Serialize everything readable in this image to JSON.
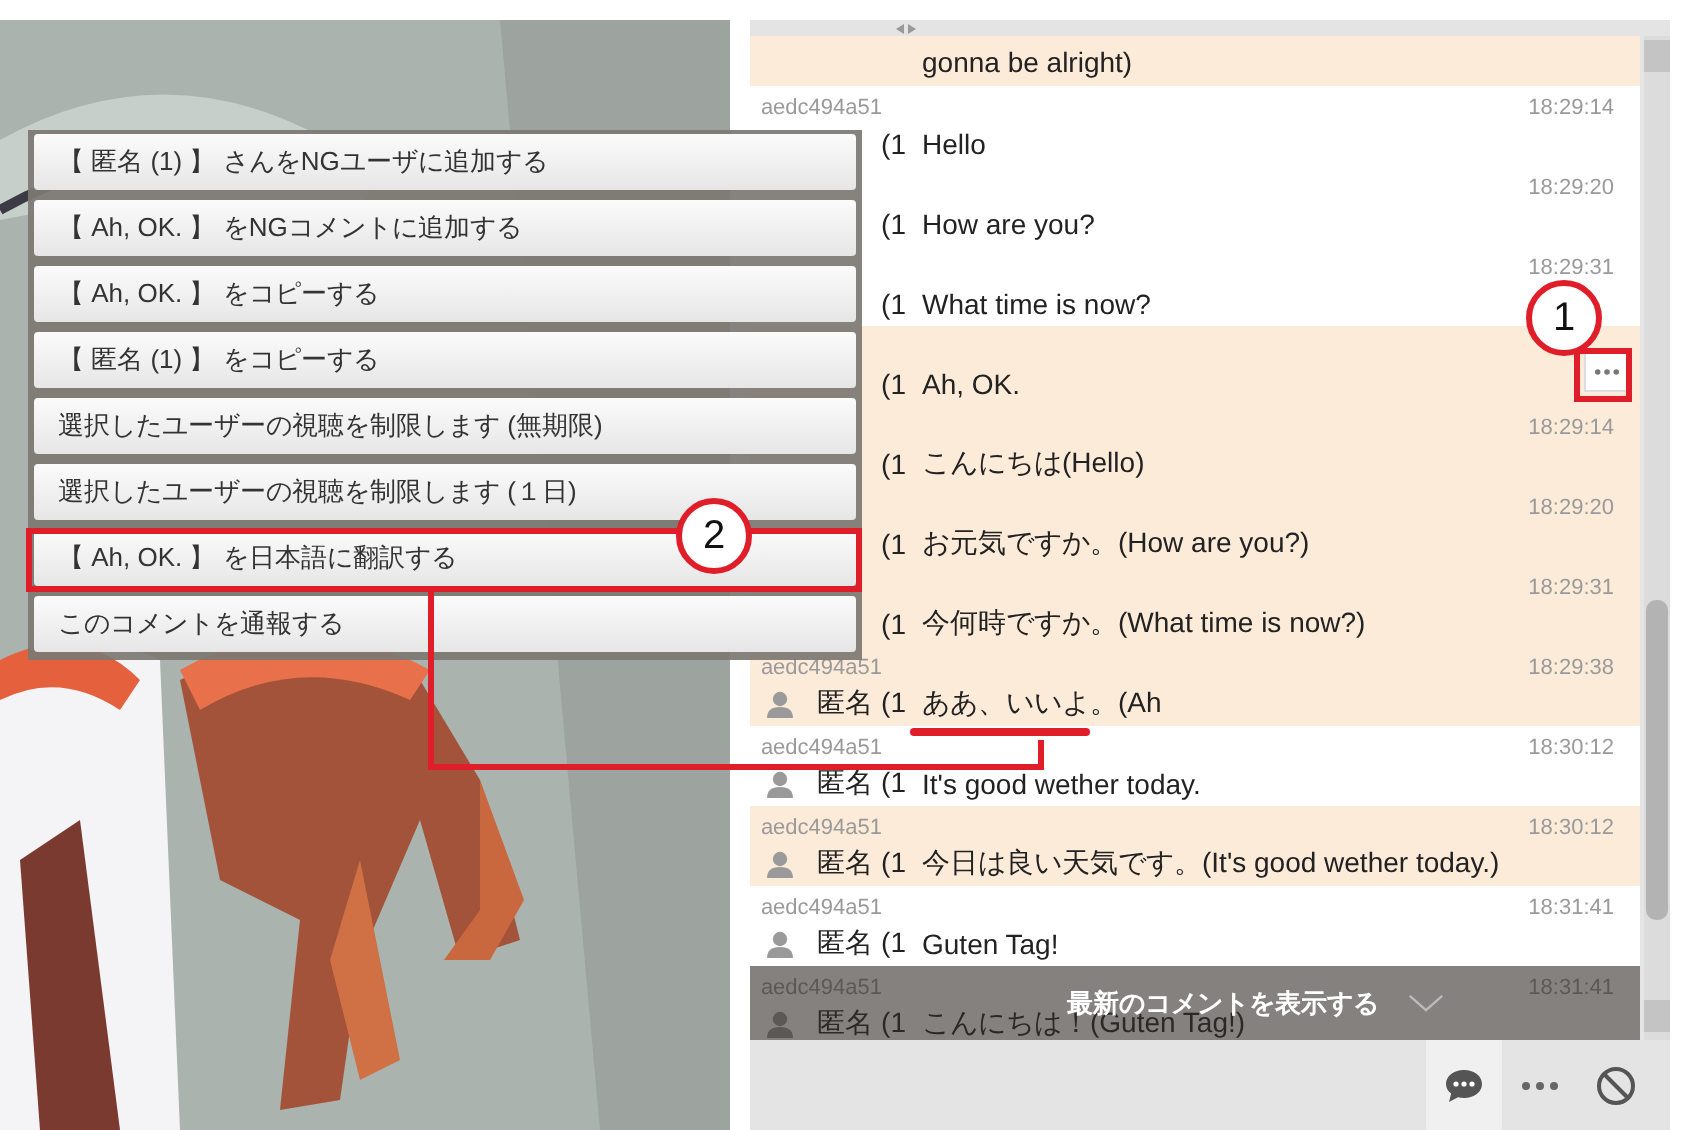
{
  "chat_panel": {
    "rows": [
      {
        "text": "gonna be alright)",
        "highlighted": true
      },
      {
        "id": "aedc494a51",
        "user": "(1",
        "avatar": false,
        "time": "18:29:14",
        "text": "Hello",
        "highlighted": false
      },
      {
        "id": "",
        "user": "(1",
        "avatar": false,
        "time": "18:29:20",
        "text": "How are you?",
        "highlighted": false
      },
      {
        "id": "",
        "user": "(1",
        "avatar": false,
        "time": "18:29:31",
        "text": "What time is now?",
        "highlighted": false
      },
      {
        "id": "",
        "user": "(1",
        "avatar": false,
        "text": "Ah, OK.",
        "highlighted": true,
        "menu_button": true
      },
      {
        "id": "",
        "user": "(1",
        "avatar": false,
        "time": "18:29:14",
        "text": "こんにちは(Hello)",
        "highlighted": true
      },
      {
        "id": "",
        "user": "(1",
        "avatar": false,
        "time": "18:29:20",
        "text": "お元気ですか。(How are you?)",
        "highlighted": true
      },
      {
        "id": "",
        "user": "(1",
        "avatar": false,
        "time": "18:29:31",
        "text": "今何時ですか。(What time is now?)",
        "highlighted": true
      },
      {
        "id": "aedc494a51",
        "user": "匿名 (1",
        "avatar": true,
        "time": "18:29:38",
        "text": "ああ、いいよ。(Ah",
        "highlighted": true
      },
      {
        "id": "aedc494a51",
        "user": "匿名 (1",
        "avatar": true,
        "time": "18:30:12",
        "text": "It's good wether today.",
        "highlighted": false
      },
      {
        "id": "aedc494a51",
        "user": "匿名 (1",
        "avatar": true,
        "time": "18:30:12",
        "text": "今日は良い天気です。(It's good wether today.)",
        "highlighted": true
      },
      {
        "id": "aedc494a51",
        "user": "匿名 (1",
        "avatar": true,
        "time": "18:31:41",
        "text": "Guten Tag!",
        "highlighted": false
      },
      {
        "id": "aedc494a51",
        "user": "匿名 (1",
        "avatar": true,
        "time": "18:31:41",
        "text": "こんにちは！(Guten Tag!)",
        "highlighted": false
      }
    ],
    "new_comments_banner": "最新のコメントを表示する",
    "toolbar": [
      {
        "kind": "comment",
        "selected": true
      },
      {
        "kind": "more",
        "selected": false
      },
      {
        "kind": "block",
        "selected": false
      }
    ]
  },
  "context_menu": {
    "items": [
      "【 匿名 (1) 】 さんをNGユーザに追加する",
      "【 Ah, OK. 】 をNGコメントに追加する",
      "【 Ah, OK. 】 をコピーする",
      "【 匿名 (1) 】 をコピーする",
      "選択したユーザーの視聴を制限します (無期限)",
      "選択したユーザーの視聴を制限します (１日)",
      "【 Ah, OK. 】 を日本語に翻訳する",
      "このコメントを通報する"
    ]
  },
  "annotations": [
    {
      "label": "1"
    },
    {
      "label": "2"
    }
  ]
}
